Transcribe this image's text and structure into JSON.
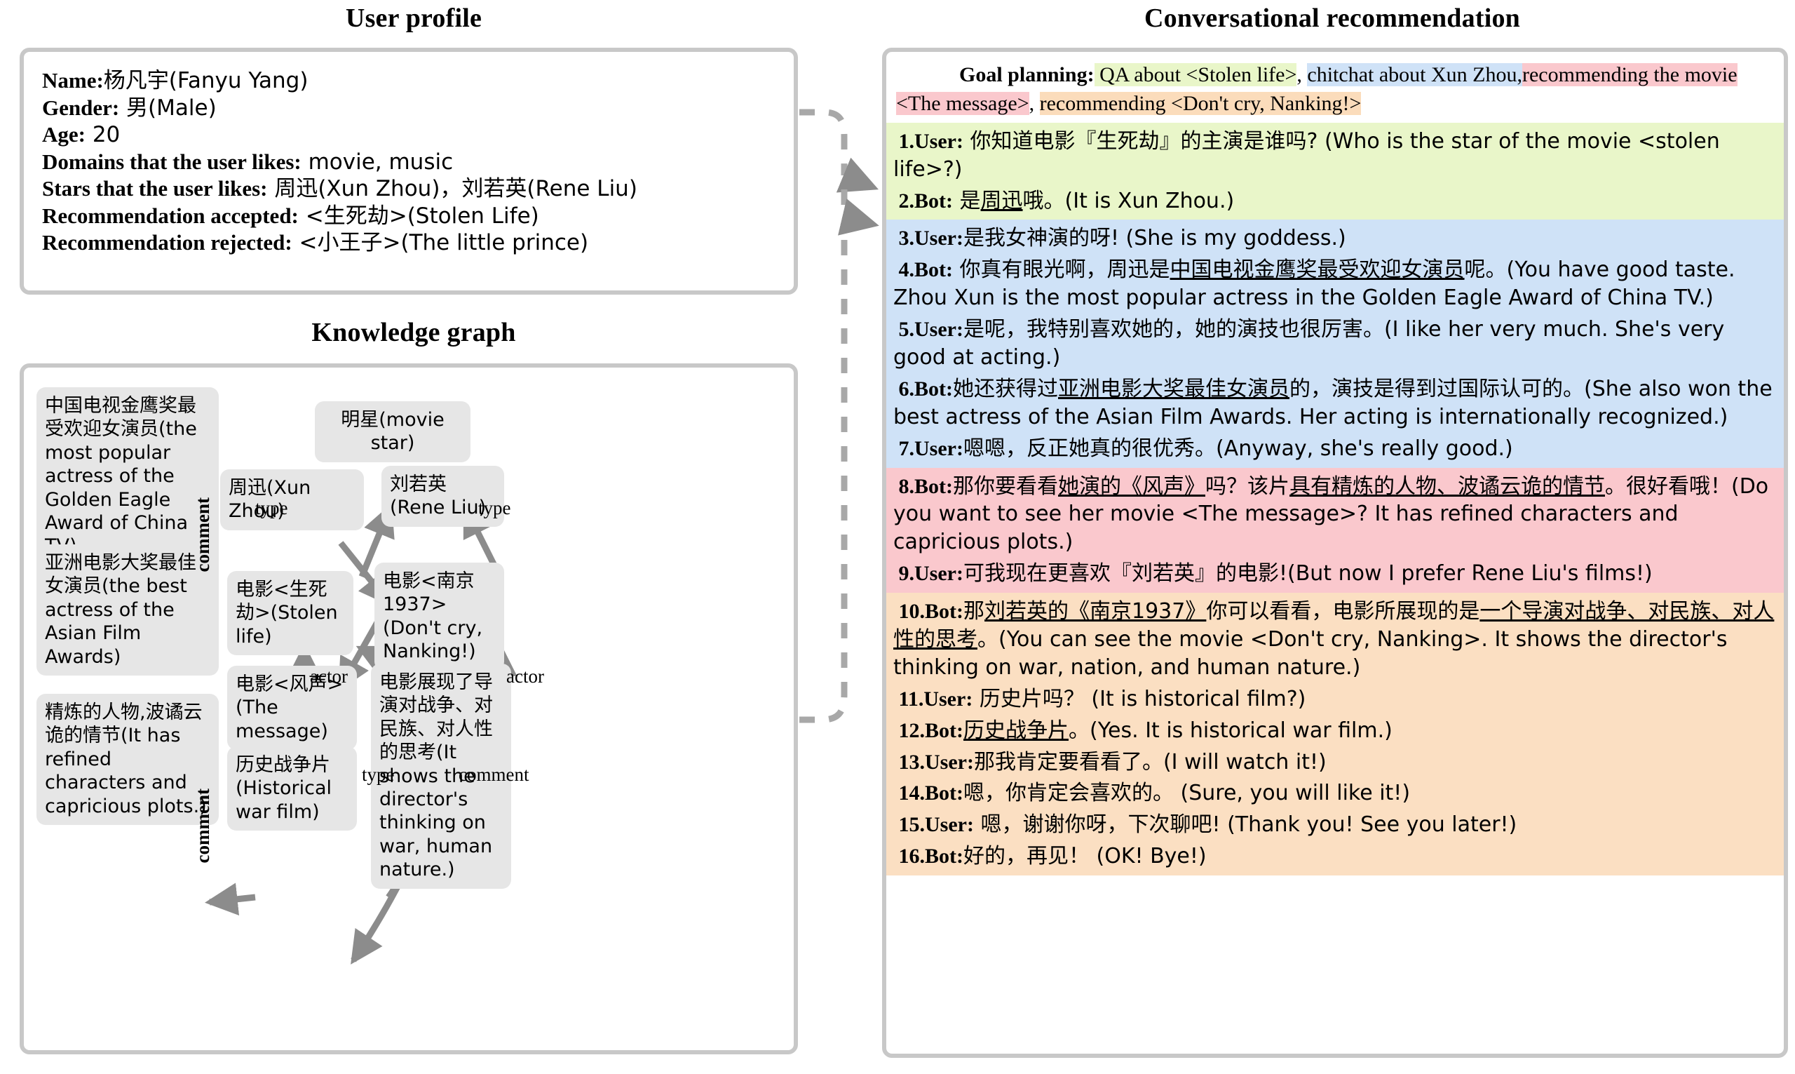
{
  "panels": {
    "user_profile_title": "User profile",
    "knowledge_graph_title": "Knowledge graph",
    "conversation_title": "Conversational recommendation"
  },
  "user_profile": {
    "rows": [
      {
        "label": "Name:",
        "value": "杨凡宇(Fanyu Yang)"
      },
      {
        "label": "Gender:",
        "value": " 男(Male)"
      },
      {
        "label": "Age:",
        "value": " 20"
      },
      {
        "label": "Domains that the user likes:",
        "value": " movie, music"
      },
      {
        "label": "Stars that the user likes:",
        "value": " 周迅(Xun Zhou)，刘若英(Rene Liu)"
      },
      {
        "label": "Recommendation accepted:",
        "value": " <生死劫>(Stolen Life)"
      },
      {
        "label": "Recommendation rejected:",
        "value": " <小王子>(The little prince)"
      }
    ]
  },
  "knowledge_graph": {
    "nodes": [
      {
        "id": "award_golden_eagle",
        "text": "中国电视金鹰奖最受欢迎女演员(the most popular actress of the Golden Eagle Award of China TV)"
      },
      {
        "id": "award_asian_film",
        "text": "亚洲电影大奖最佳女演员(the best actress of the Asian Film Awards)"
      },
      {
        "id": "comment_message",
        "text": "精炼的人物,波谲云诡的情节(It has refined characters and capricious plots.)"
      },
      {
        "id": "movie_star",
        "text": "明星(movie star)"
      },
      {
        "id": "xun_zhou",
        "text": "周迅(Xun Zhou)"
      },
      {
        "id": "rene_liu",
        "text": "刘若英(Rene Liu)"
      },
      {
        "id": "movie_stolen_life",
        "text": "电影<生死劫>(Stolen life)"
      },
      {
        "id": "movie_nanjing",
        "text": "电影<南京1937>(Don't cry, Nanking!)"
      },
      {
        "id": "movie_message",
        "text": "电影<风声>(The message)"
      },
      {
        "id": "genre_war_film",
        "text": "历史战争片(Historical war film)"
      },
      {
        "id": "comment_nanjing",
        "text": "电影展现了导演对战争、对民族、对人性的思考(It shows the director's thinking on war, human nature.)"
      }
    ],
    "edge_labels": {
      "comment_upper": "comment",
      "comment_lower": "comment",
      "type_left": "type",
      "type_right": "type",
      "actor_left": "actor",
      "actor_right": "actor",
      "type_genre": "type",
      "comment_nanjing": "comment"
    }
  },
  "conversation": {
    "goal_planning": {
      "label": "Goal planning:",
      "segments": [
        {
          "text": " QA about <Stolen life>",
          "highlight": "green"
        },
        {
          "text": ", ",
          "highlight": "none"
        },
        {
          "text": "chitchat about Xun Zhou,",
          "highlight": "blue"
        },
        {
          "text": "recommending the movie <The message>",
          "highlight": "pink"
        },
        {
          "text": ", ",
          "highlight": "none"
        },
        {
          "text": "recommending <Don't cry, Nanking!>",
          "highlight": "orange"
        }
      ]
    },
    "blocks": [
      {
        "color": "green",
        "turns": [
          {
            "n": "1.",
            "speaker": "User:",
            "parts": [
              {
                "t": " 你知道电影『生死劫』的主演是谁吗? (Who is the star of the movie <stolen life>?)",
                "u": false
              }
            ]
          },
          {
            "n": "2.",
            "speaker": "Bot:",
            "parts": [
              {
                "t": " 是",
                "u": false
              },
              {
                "t": "周迅",
                "u": true
              },
              {
                "t": "哦。(It is Xun Zhou.)",
                "u": false
              }
            ]
          }
        ]
      },
      {
        "color": "blue",
        "turns": [
          {
            "n": "3.",
            "speaker": "User:",
            "parts": [
              {
                "t": "是我女神演的呀! (She is my goddess.)",
                "u": false
              }
            ]
          },
          {
            "n": "4.",
            "speaker": "Bot:",
            "parts": [
              {
                "t": " 你真有眼光啊，周迅是",
                "u": false
              },
              {
                "t": "中国电视金鹰奖最受欢迎女演员",
                "u": true
              },
              {
                "t": "呢。(You have good taste. Zhou Xun is the most popular actress in the Golden Eagle Award of China TV.)",
                "u": false
              }
            ]
          },
          {
            "n": "5.",
            "speaker": "User:",
            "parts": [
              {
                "t": "是呢，我特别喜欢她的，她的演技也很厉害。(I like her very much. She's very good at acting.)",
                "u": false
              }
            ]
          },
          {
            "n": "6.",
            "speaker": "Bot:",
            "parts": [
              {
                "t": "她还获得过",
                "u": false
              },
              {
                "t": "亚洲电影大奖最佳女演员",
                "u": true
              },
              {
                "t": "的，演技是得到过国际认可的。(She also won the best actress of the Asian Film Awards. Her acting is internationally recognized.)",
                "u": false
              }
            ]
          },
          {
            "n": "7.",
            "speaker": "User:",
            "parts": [
              {
                "t": "嗯嗯，反正她真的很优秀。(Anyway, she's really good.)",
                "u": false
              }
            ]
          }
        ]
      },
      {
        "color": "pink",
        "turns": [
          {
            "n": "8.",
            "speaker": "Bot:",
            "parts": [
              {
                "t": "那你要看看",
                "u": false
              },
              {
                "t": "她演的《风声》",
                "u": true
              },
              {
                "t": "吗？该片",
                "u": false
              },
              {
                "t": "具有精炼的人物、波谲云诡的情节",
                "u": true
              },
              {
                "t": "。很好看哦！(Do you want to see her movie <The message>? It has refined characters and capricious plots.)",
                "u": false
              }
            ]
          },
          {
            "n": "9.",
            "speaker": "User:",
            "parts": [
              {
                "t": "可我现在更喜欢『刘若英』的电影!(But now I prefer Rene Liu's films!)",
                "u": false
              }
            ]
          }
        ]
      },
      {
        "color": "orange",
        "turns": [
          {
            "n": "10.",
            "speaker": "Bot:",
            "parts": [
              {
                "t": "那",
                "u": false
              },
              {
                "t": "刘若英的《南京1937》",
                "u": true
              },
              {
                "t": "你可以看看，电影所展现的是",
                "u": false
              },
              {
                "t": "一个导演对战争、对民族、对人性的思考",
                "u": true
              },
              {
                "t": "。(You can see the movie <Don't cry, Nanking>. It shows the director's thinking on war, nation, and human nature.)",
                "u": false
              }
            ]
          },
          {
            "n": "11.",
            "speaker": "User:",
            "parts": [
              {
                "t": " 历史片吗？ (It is historical film?)",
                "u": false
              }
            ]
          },
          {
            "n": "12.",
            "speaker": "Bot:",
            "parts": [
              {
                "t": "历史战争片",
                "u": true
              },
              {
                "t": "。(Yes. It is historical war film.)",
                "u": false
              }
            ]
          },
          {
            "n": "13.",
            "speaker": "User:",
            "parts": [
              {
                "t": "那我肯定要看看了。(I will watch it!)",
                "u": false
              }
            ]
          },
          {
            "n": "14.",
            "speaker": "Bot:",
            "parts": [
              {
                "t": "嗯，你肯定会喜欢的。 (Sure, you will like it!)",
                "u": false
              }
            ]
          },
          {
            "n": "15.",
            "speaker": "User:",
            "parts": [
              {
                "t": " 嗯，谢谢你呀，下次聊吧! (Thank you! See you later!)",
                "u": false
              }
            ]
          },
          {
            "n": "16.",
            "speaker": "Bot:",
            "parts": [
              {
                "t": "好的，再见！ (OK! Bye!)",
                "u": false
              }
            ]
          }
        ]
      }
    ]
  },
  "colors": {
    "green": "#e9f6c9",
    "blue": "#cfe2f7",
    "pink": "#fac8cd",
    "orange": "#fbdfc2",
    "node_fill": "#e6e6e6",
    "border": "#c8c8c8",
    "arrow": "#808080"
  }
}
